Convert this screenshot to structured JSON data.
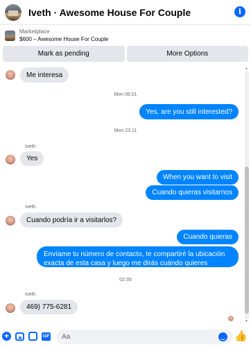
{
  "header": {
    "title": "Iveth · Awesome House For Couple",
    "info_icon": "i"
  },
  "marketplace": {
    "label": "Marketplace",
    "listing": "$600 – Awesome House For Couple"
  },
  "actions": {
    "mark_pending": "Mark as pending",
    "more_options": "More Options"
  },
  "messages": {
    "m1": "Me interesa",
    "ts1": "Mon 06:01",
    "m2": "Yes, are you still interested?",
    "ts2": "Mon 23:11",
    "sender1": "Iveth",
    "m3": "Yes",
    "m4": "When you want to visit",
    "m5": "Cuando quieras visitarnos",
    "sender2": "Iveth",
    "m6": "Cuando podría ir a visitarlos?",
    "m7": "Cuando quieras",
    "m8": "Envíame tu número de contacto, te compartiré la ubicación exacta de esta casa y luego me dirás cuándo quieres visitarla.",
    "ts3": "02:39",
    "sender3": "Iveth",
    "m9": "469) 775-6281"
  },
  "composer": {
    "placeholder": "Aa",
    "gif_label": "GIF"
  },
  "colors": {
    "accent": "#0866ff",
    "outgoing_bubble": "#0084ff",
    "incoming_bubble": "#e4e6eb"
  }
}
